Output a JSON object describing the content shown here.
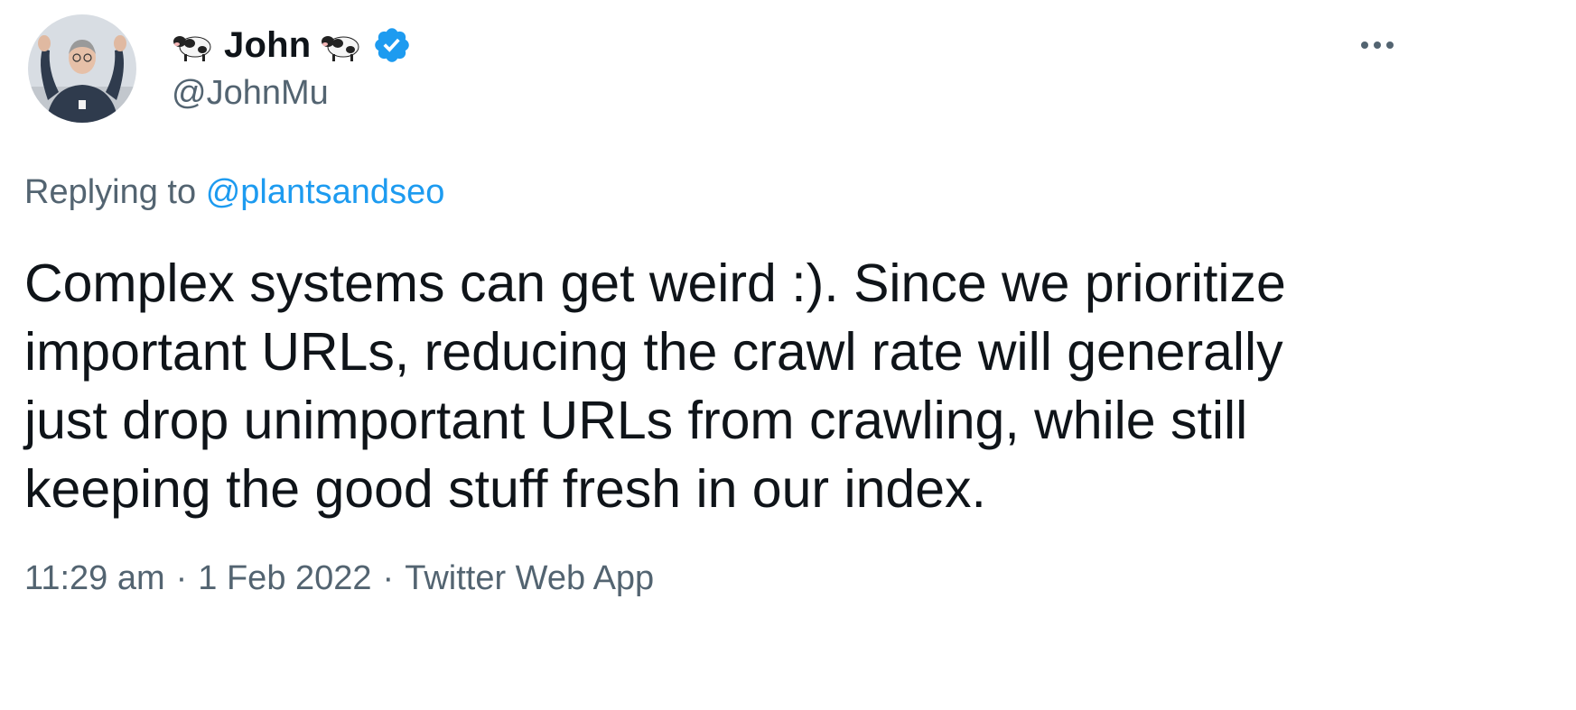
{
  "author": {
    "emoji_left": "cow-icon",
    "name": "John",
    "emoji_right": "cow-icon",
    "verified": true,
    "handle": "@JohnMu"
  },
  "reply": {
    "prefix": "Replying to",
    "mention": "@plantsandseo"
  },
  "tweet": {
    "text": "Complex systems can get weird :). Since we prioritize\nimportant URLs, reducing the crawl rate will generally\njust drop unimportant URLs from crawling, while still\nkeeping the good stuff fresh in our index."
  },
  "meta": {
    "time": "11:29 am",
    "separator": "·",
    "date": "1 Feb 2022",
    "source": "Twitter Web App"
  },
  "colors": {
    "text": "#0f1419",
    "secondary": "#536471",
    "link": "#1d9bf0",
    "verified": "#1d9bf0"
  }
}
